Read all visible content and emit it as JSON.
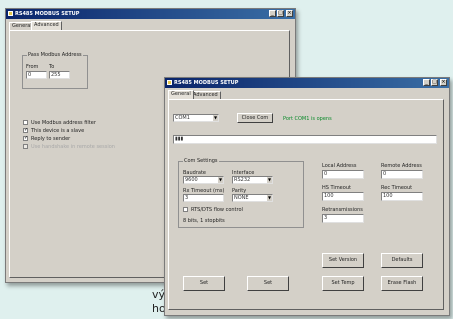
{
  "background_text": {
    "line1": "výstupů",
    "line2": "ho softwaru"
  },
  "window_back": {
    "title": "RS485 MODBUS SETUP",
    "tabs": [
      "General",
      "Advanced"
    ],
    "group_title": "Pass Modbus Address",
    "from_label": "From",
    "to_label": "To",
    "from_value": "0",
    "to_value": "255",
    "checkboxes": [
      {
        "label": "Use Modbus address filter",
        "checked": false,
        "disabled": false
      },
      {
        "label": "This device is a slave",
        "checked": true,
        "disabled": false
      },
      {
        "label": "Reply to sender",
        "checked": true,
        "disabled": false
      },
      {
        "label": "Use handshake in remote session",
        "checked": false,
        "disabled": true
      }
    ]
  },
  "window_front": {
    "title": "RS485 MODBUS SETUP",
    "tabs": [
      "General",
      "Advanced"
    ],
    "port_value": "COM1",
    "close_port_label": "Close Com",
    "port_status": "Port COM1 is opens",
    "data_line": "▮▮▮",
    "com_settings": {
      "title": "Com Settings",
      "baudrate_label": "Baudrate",
      "baudrate_value": "9600",
      "interface_label": "Interface",
      "interface_value": "RS232",
      "rxtimeout_label": "Rx Timeout (ms)",
      "rxtimeout_value": "3",
      "parity_label": "Parity",
      "parity_value": "NONE",
      "flow_label": "RTS/DTS flow control",
      "format_text": "8 bits, 1 stopbits"
    },
    "local_address_label": "Local Address",
    "local_address_value": "0",
    "remote_address_label": "Remote Address",
    "remote_address_value": "0",
    "hs_timeout_label": "HS Timeout",
    "hs_timeout_value": "100",
    "rec_timeout_label": "Rec Timeout",
    "rec_timeout_value": "100",
    "retransmissions_label": "Retransmissions",
    "retransmissions_value": "3",
    "buttons": {
      "set1": "Set",
      "set2": "Set",
      "set_version": "Set Version",
      "defaults": "Defaults",
      "set_temp": "Set Temp",
      "erase_flash": "Erase Flash"
    }
  }
}
